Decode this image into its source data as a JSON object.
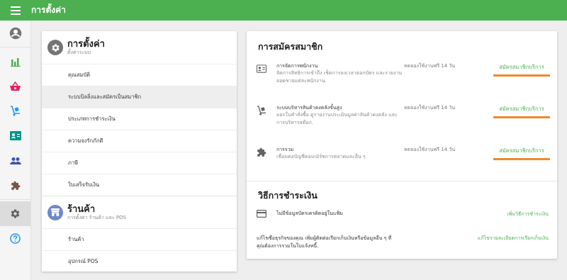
{
  "header": {
    "title": "การตั้งค่า",
    "menu_icon": "hamburger-menu-icon"
  },
  "sidebar": {
    "items": [
      {
        "icon": "account-circle-icon",
        "color": "#757575"
      },
      {
        "icon": "bar-chart-icon",
        "color": "#4caf50"
      },
      {
        "icon": "shopping-basket-icon",
        "color": "#e91e63"
      },
      {
        "icon": "dolly-icon",
        "color": "#2196f3"
      },
      {
        "icon": "id-card-icon",
        "color": "#009688"
      },
      {
        "icon": "people-icon",
        "color": "#3f51b5"
      },
      {
        "icon": "puzzle-icon",
        "color": "#795548"
      },
      {
        "icon": "gear-icon",
        "color": "#616161",
        "active": true
      },
      {
        "icon": "help-icon",
        "color": "#2196f3"
      }
    ]
  },
  "settings": {
    "title": "การตั้งค่า",
    "subtitle": "ตั้งค่าระบบ",
    "items": [
      "คุณสมบัติ",
      "ระบบบิลลิ่งและสมัครเป็นสมาชิก",
      "ประเภทการชำระเงิน",
      "ความจงรักภักดี",
      "ภาษี",
      "ใบเสร็จรับเงิน"
    ],
    "selected_index": 1
  },
  "store": {
    "title": "ร้านค้า",
    "subtitle": "การตั้งค่า ร้านค้า และ POS",
    "items": [
      "ร้านค้า",
      "อุปกรณ์ POS"
    ]
  },
  "subscription": {
    "title": "การสมัครสมาชิก",
    "services": [
      {
        "icon": "id-card-icon",
        "name": "การจัดการพนักงาน",
        "description": "จัดการสิทธิการเข้าถึง เช็คการลงเวลาตอกบัตร และรายงานยอดขายแต่ละพนักงาน.",
        "trial": "ทดลองใช้งานฟรี 14 วัน",
        "button": "สมัครสมาชิกบริการ"
      },
      {
        "icon": "dolly-icon",
        "name": "ระบบบริหารสินค้าคงคลังขั้นสูง",
        "description": "ออกใบคำสั่งซื้อ ดูรายงานประเมินมูลค่าสินค้าคงคลัง และการบริหารสต๊อก.",
        "trial": "ทดลองใช้งานฟรี 14 วัน",
        "button": "สมัครสมาชิกบริการ"
      },
      {
        "icon": "puzzle-icon",
        "name": "การรวม",
        "description": "เชื่อมต่อบัญชีคอมเมิร์ซการตลาดและอื่น ๆ",
        "trial": "ทดลองใช้งานฟรี 14 วัน",
        "button": "สมัครสมาชิกบริการ"
      }
    ],
    "accent_color": "#f0892a",
    "link_color": "#4caf50"
  },
  "payment": {
    "title": "วิธีการชำระเงิน",
    "card_text": "ไม่มีข้อมูลบัตรเครดิตอยู่ในแฟ้ม",
    "card_link": "เพิ่มวิธีการชำระเงิน",
    "billing_text": "แก้ไขชื่อธุรกิจของคุณ เพิ่มผู้ติดต่อเรียกเก็บเงินหรือข้อมูลอื่น ๆ ที่คุณต้องการรวมในใบแจ้งหนี้.",
    "billing_link": "แก้ไขรายละเอียดการเรียกเก็บเงิน"
  },
  "colors": {
    "brand": "#4caf50",
    "accent": "#f0892a"
  }
}
